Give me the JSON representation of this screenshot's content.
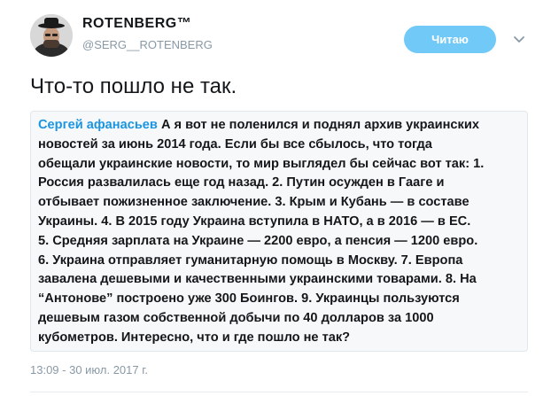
{
  "author": {
    "display_name": "ROTENBERG™",
    "handle": "@SERG__ROTENBERG"
  },
  "follow_button": {
    "label": "Читаю"
  },
  "tweet": {
    "text": "Что-то пошло не так.",
    "timestamp": "13:09 - 30 июл. 2017 г."
  },
  "quote": {
    "author": "Сергей афанасьев",
    "lines": [
      " А я вот не поленился и поднял архив украинских",
      "новостей за июнь 2014 года. Если бы все сбылось, что тогда",
      "обещали украинские новости, то мир выглядел бы сейчас вот так: 1.",
      "Россия развалилась еще год назад. 2. Путин осужден в Гааге и",
      "отбывает пожизненное заключение. 3. Крым и Кубань — в составе",
      "Украины. 4. В 2015 году Украина вступила в НАТО, а в 2016 — в ЕС.",
      "5. Средняя зарплата на Украине — 2200 евро, а пенсия — 1200 евро.",
      "6. Украина отправляет гуманитарную помощь в Москву. 7. Европа",
      "завалена дешевыми и качественными украинскими товарами. 8. На",
      "“Антонове” построено уже 300 Боингов. 9. Украинцы пользуются",
      "дешевым газом собственной добычи по 40 долларов за 1000",
      "кубометров. Интересно, что и где пошло не так?"
    ]
  },
  "colors": {
    "accent": "#1b95e0",
    "follow_button_bg": "#71c9f8",
    "muted_text": "#8899a6",
    "quote_bg": "#f7f8f9"
  },
  "icons": {
    "avatar": "user-avatar-photo",
    "menu": "chevron-down-icon"
  }
}
